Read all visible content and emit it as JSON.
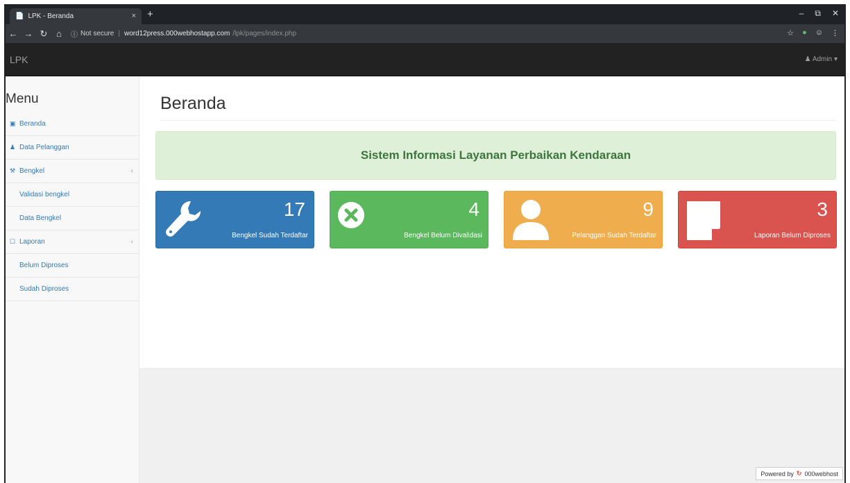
{
  "browser": {
    "tab_title": "LPK - Beranda",
    "tab_close": "×",
    "new_tab": "+",
    "security": "Not secure",
    "url_host": "word12press.000webhostapp.com",
    "url_path": "/lpk/pages/index.php"
  },
  "navbar": {
    "brand": "LPK",
    "user": "Admin"
  },
  "sidebar": {
    "title": "Menu",
    "items": [
      {
        "label": "Beranda",
        "icon": "dashboard-icon"
      },
      {
        "label": "Data Pelanggan",
        "icon": "user-icon"
      },
      {
        "label": "Bengkel",
        "icon": "wrench-icon",
        "has_arrow": true
      },
      {
        "label": "Validasi bengkel",
        "sub": true
      },
      {
        "label": "Data Bengkel",
        "sub": true
      },
      {
        "label": "Laporan",
        "icon": "checkbox-icon",
        "has_arrow": true
      },
      {
        "label": "Belum Diproses",
        "sub": true
      },
      {
        "label": "Sudah Diproses",
        "sub": true
      }
    ]
  },
  "main": {
    "page_title": "Beranda",
    "banner": "Sistem Informasi Layanan Perbaikan Kendaraan",
    "cards": [
      {
        "count": "17",
        "label": "Bengkel Sudah Terdaftar",
        "icon": "wrench-icon",
        "color": "#337ab7"
      },
      {
        "count": "4",
        "label": "Bengkel Belum Divalidasi",
        "icon": "times-circle-icon",
        "color": "#5cb85c"
      },
      {
        "count": "9",
        "label": "Pelanggan Sudah Terdaftar",
        "icon": "user-icon",
        "color": "#f0ad4e"
      },
      {
        "count": "3",
        "label": "Laporan Belum Diproses",
        "icon": "sticky-note-icon",
        "color": "#d9534f"
      }
    ]
  },
  "footer": {
    "powered_by": "Powered by",
    "host_brand": "000webhost"
  }
}
